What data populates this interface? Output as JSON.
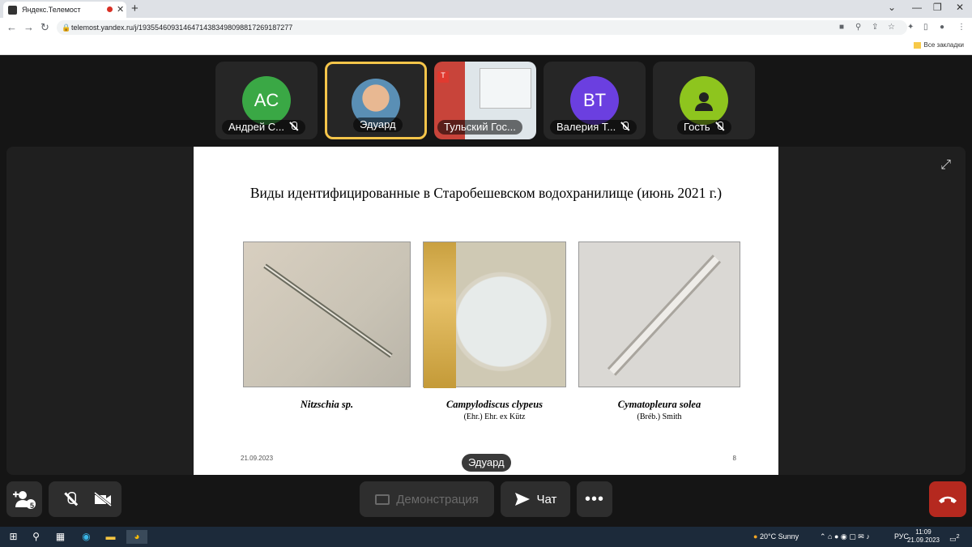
{
  "browser": {
    "tab_title": "Яндекс.Телемост",
    "url": "telemost.yandex.ru/j/19355460931464714383498098817269187277",
    "bookmarks_label": "Все закладки"
  },
  "participants": [
    {
      "name": "Андрей С...",
      "initials": "AC",
      "color": "#3aa845",
      "muted": true
    },
    {
      "name": "Эдуард",
      "initials": "",
      "color": "#5a8fb5",
      "muted": false,
      "active": true
    },
    {
      "name": "Тульский Гос...",
      "initials": "",
      "color": "#6b5350",
      "muted": false
    },
    {
      "name": "Валерия Т...",
      "initials": "BT",
      "color": "#6b3fe0",
      "muted": true
    },
    {
      "name": "Гость",
      "initials": "",
      "color": "#8ec51e",
      "muted": true
    }
  ],
  "slide": {
    "title": "Виды идентифицированные  в Старобешевском водохранилище (июнь 2021 г.)",
    "species": [
      {
        "name": "Nitzschia sp.",
        "author": ""
      },
      {
        "name": "Campylodiscus clypeus",
        "author": "(Ehr.) Ehr. ex Kütz"
      },
      {
        "name": "Cymatopleura solea",
        "author": "(Bréb.) Smith"
      }
    ],
    "date": "21.09.2023",
    "page": "8"
  },
  "speaker_label": "Эдуард",
  "controls": {
    "participants_count": "5",
    "demo_label": "Демонстрация",
    "chat_label": "Чат"
  },
  "taskbar": {
    "weather": "20°C  Sunny",
    "lang": "РУС",
    "time": "11:09",
    "date": "21.09.2023",
    "notifications": "2"
  }
}
